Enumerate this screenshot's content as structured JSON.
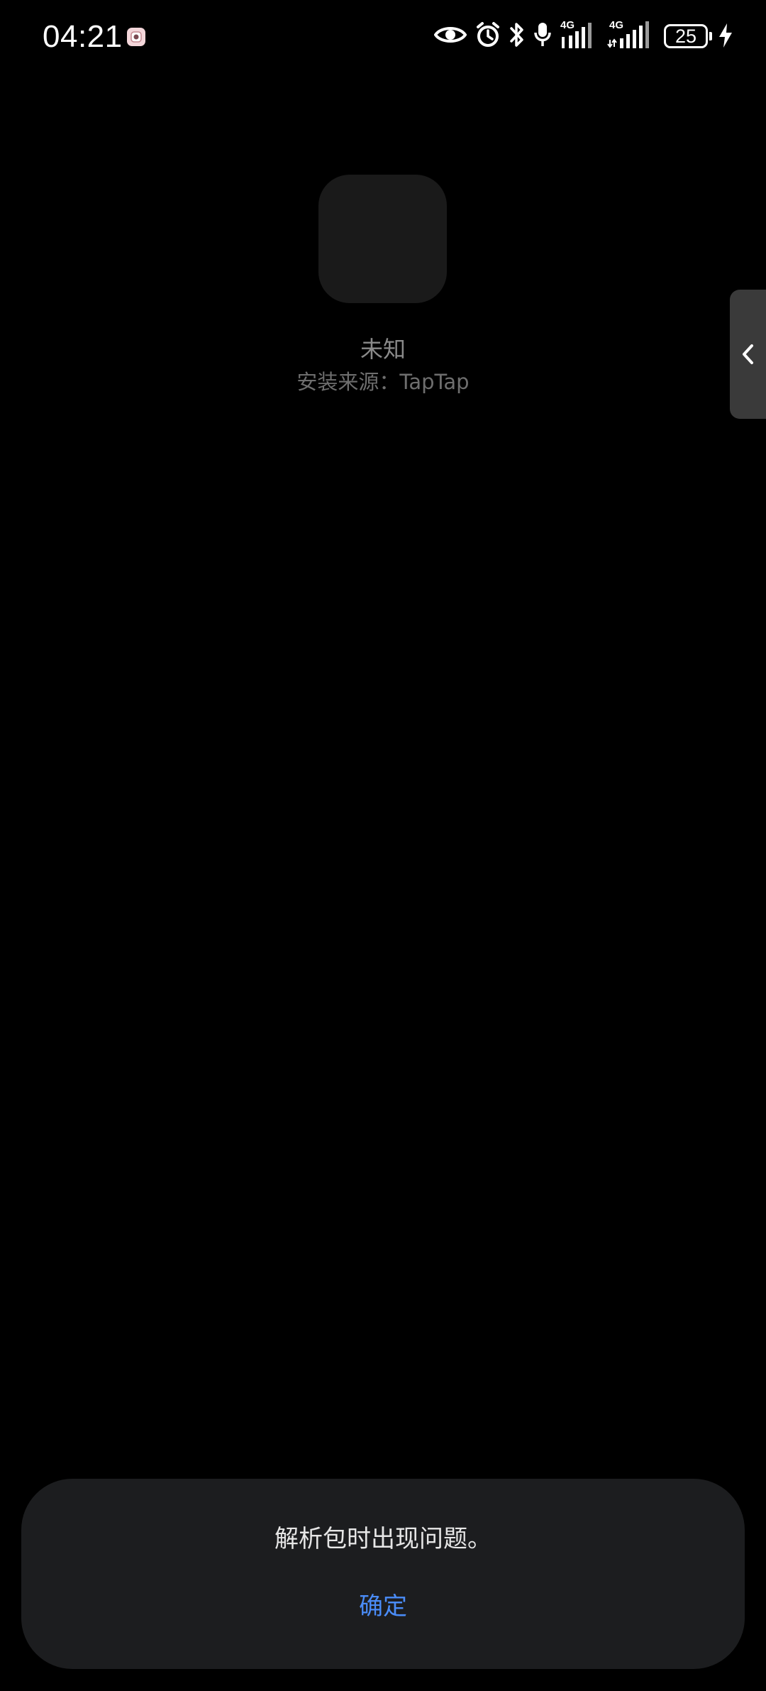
{
  "status_bar": {
    "time": "04:21",
    "battery_level": "25",
    "network_1": "4G",
    "network_2": "4G",
    "icons": [
      "notification-app-icon",
      "eye-icon",
      "alarm-icon",
      "bluetooth-icon",
      "microphone-icon",
      "signal-icon",
      "signal-icon",
      "battery-icon",
      "charging-icon"
    ]
  },
  "app": {
    "name": "未知",
    "install_source": "安装来源：TapTap"
  },
  "side_handle": {
    "icon": "chevron-left-icon"
  },
  "dialog": {
    "message": "解析包时出现问题。",
    "confirm_label": "确定",
    "accent_color": "#4a8cf7"
  }
}
